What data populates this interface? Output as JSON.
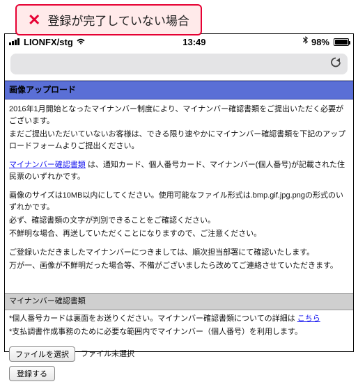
{
  "callout": {
    "text": "登録が完了していない場合"
  },
  "statusbar": {
    "carrier": "LIONFX/stg",
    "time": "13:49",
    "battery_pct": "98%"
  },
  "section": {
    "title": "画像アップロード"
  },
  "intro": {
    "p1": "2016年1月開始となったマイナンバー制度により、マイナンバー確認書類をご提出いただく必要がございます。",
    "p2": "まだご提出いただいていないお客様は、できる限り速やかにマイナンバー確認書類を下記のアップロードフォームよりご提出ください。"
  },
  "docs": {
    "link_label": "マイナンバー確認書類",
    "after_link": " は、通知カード、個人番号カード、マイナンバー(個人番号)が記載された住民票のいずれかです。"
  },
  "size": {
    "p1": "画像のサイズは10MB以内にしてください。使用可能なファイル形式は.bmp.gif.jpg.pngの形式のいずれかです。",
    "p2": "必ず、確認書類の文字が判別できることをご確認ください。",
    "p3": "不鮮明な場合、再送していただくことになりますので、ご注意ください。"
  },
  "confirm": {
    "p1": "ご登録いただきましたマイナンバーにつきましては、順次担当部署にて確認いたします。",
    "p2": "万が一、画像が不鮮明だった場合等、不備がございましたら改めてご連絡させていただきます。"
  },
  "sub": {
    "title": "マイナンバー確認書類",
    "b1_pre": "個人番号カードは裏面をお送りください。マイナンバー確認書類についての詳細は ",
    "b1_link": "こちら",
    "b2": "支払調書作成事務のために必要な範囲内でマイナンバー（個人番号）を利用します。"
  },
  "upload": {
    "choose_label": "ファイルを選択",
    "status": "ファイル未選択",
    "submit_label": "登録する"
  }
}
